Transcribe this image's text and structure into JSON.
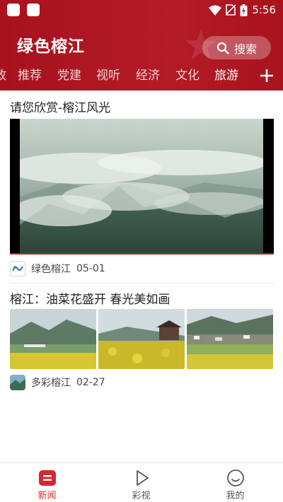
{
  "status_bar": {
    "time": "5:56"
  },
  "header": {
    "app_title": "绿色榕江",
    "search_label": "搜索",
    "tabs": [
      {
        "label": "政"
      },
      {
        "label": "推荐"
      },
      {
        "label": "党建"
      },
      {
        "label": "视听"
      },
      {
        "label": "经济"
      },
      {
        "label": "文化"
      },
      {
        "label": "旅游"
      }
    ],
    "active_tab": "旅游"
  },
  "feed": {
    "articles": [
      {
        "title": "请您欣赏-榕江风光",
        "source": "绿色榕江",
        "date": "05-01",
        "media": "video"
      },
      {
        "title": "榕江：油菜花盛开 春光美如画",
        "source": "多彩榕江",
        "date": "02-27",
        "media": "three-images"
      }
    ]
  },
  "bottom_nav": {
    "items": [
      {
        "label": "新闻",
        "active": true
      },
      {
        "label": "彩视",
        "active": false
      },
      {
        "label": "我的",
        "active": false
      }
    ]
  },
  "colors": {
    "brand_red": "#b31b26",
    "active_nav": "#d6282c"
  }
}
